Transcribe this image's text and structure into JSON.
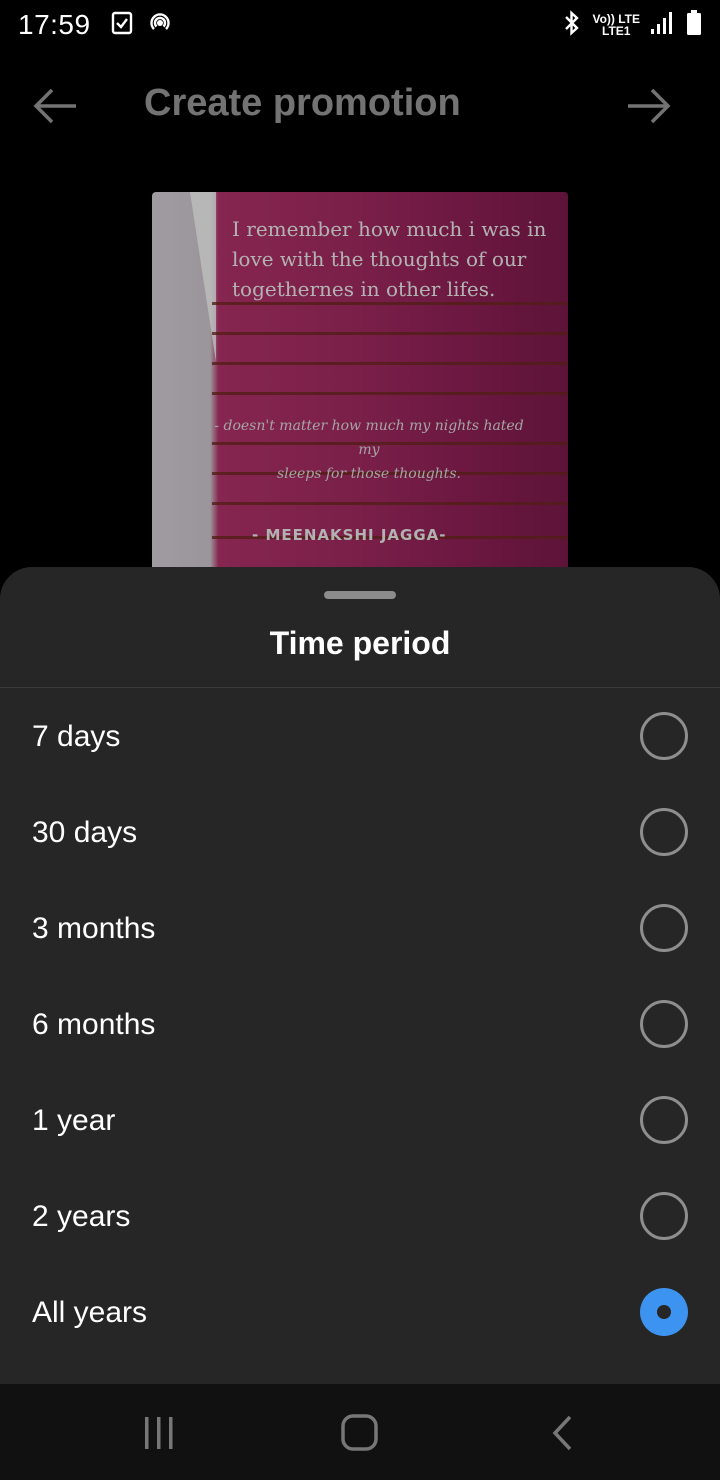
{
  "status_bar": {
    "time": "17:59",
    "net_top": "Vo)) LTE",
    "net_bottom": "LTE1",
    "icons": [
      "clipboard-check-icon",
      "hotspot-icon",
      "bluetooth-icon",
      "signal-icon",
      "battery-icon"
    ]
  },
  "header": {
    "title": "Create promotion",
    "back_icon": "arrow-left-icon",
    "next_icon": "arrow-right-icon"
  },
  "preview": {
    "quote_line_1": "I remember how much i was in",
    "quote_line_2": "love with the thoughts of our",
    "quote_line_3": "togethernes in other lifes.",
    "sub_line_1": "- doesn't matter how much my nights hated my",
    "sub_line_2": "sleeps for those thoughts.",
    "author": "- MEENAKSHI JAGGA-"
  },
  "sheet": {
    "title": "Time period",
    "options": [
      {
        "label": "7 days",
        "selected": false
      },
      {
        "label": "30 days",
        "selected": false
      },
      {
        "label": "3 months",
        "selected": false
      },
      {
        "label": "6 months",
        "selected": false
      },
      {
        "label": "1 year",
        "selected": false
      },
      {
        "label": "2 years",
        "selected": false
      },
      {
        "label": "All years",
        "selected": true
      }
    ]
  },
  "colors": {
    "sheet_bg": "#262626",
    "radio_selected": "#3d94f0",
    "radio_border": "#8e8e8e"
  },
  "nav_bar": {
    "icons": [
      "recents-icon",
      "home-icon",
      "back-icon"
    ]
  }
}
